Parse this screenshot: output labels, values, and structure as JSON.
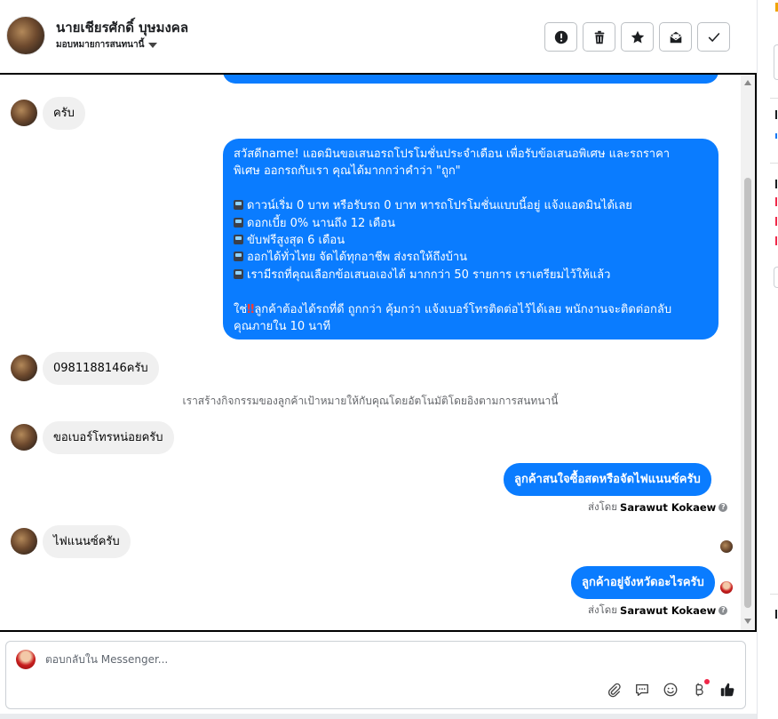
{
  "header": {
    "contact_name": "นายเชียรศักดิ์ บุษมงคล",
    "assign_label": "มอบหมายการสนทนานี้"
  },
  "toolbar": {
    "spam_icon": "exclamation-circle-icon",
    "delete_icon": "trash-icon",
    "star_icon": "star-icon",
    "mark_unread_icon": "envelope-open-icon",
    "done_icon": "checkmark-icon"
  },
  "messages": {
    "m1": "ครับ",
    "promo_lines": [
      "สวัสดีname! แอดมินขอเสนอรถโปรโมชั่นประจำเดือน เพื่อรับข้อเสนอพิเศษ และรถราคา",
      "พิเศษ ออกรถกับเรา คุณได้มากกว่าคำว่า \"ถูก\"",
      "",
      "ดาวน์เริ่ม 0 บาท หรือรับรถ 0 บาท หารถโปรโมชั่นแบบนี้อยู่ แจ้งแอดมินได้เลย",
      "ดอกเบี้ย 0% นานถึง 12 เดือน",
      "ขับฟรีสูงสุด 6 เดือน",
      "ออกได้ทั่วไทย จัดได้ทุกอาชีพ ส่งรถให้ถึงบ้าน",
      "เรามีรถที่คุณเลือกข้อเสนอเองได้ มากกว่า 50 รายการ เราเตรียมไว้ให้แล้ว",
      "",
      "ลูกค้าต้องได้รถที่ดี ถูกกว่า คุ้มกว่า แจ้งเบอร์โทรติดต่อไว้ได้เลย พนักงานจะติดต่อกลับ",
      "คุณภายใน 10 นาที"
    ],
    "promo_line10_prefix": "ใช่",
    "m2": "0981188146ครับ",
    "system_note": "เราสร้างกิจกรรมของลูกค้าเป้าหมายให้กับคุณโดยอัตโนมัติโดยอิงตามการสนทนานี้",
    "m3": "ขอเบอร์โทรหน่อยครับ",
    "m4": "ลูกค้าสนใจซื้อสดหรือจัดไฟแนนซ์ครับ",
    "m5": "ไฟแนนซ์ครับ",
    "m6": "ลูกค้าอยู่จังหวัดอะไรครับ",
    "sent_by_label": "ส่งโดย",
    "sent_by_name": "Sarawut Kokaew",
    "info_glyph": "?"
  },
  "composer": {
    "placeholder": "ตอบกลับใน Messenger..."
  },
  "colors": {
    "outgoing": "#0a7cff",
    "incoming": "#f0f0f0"
  }
}
